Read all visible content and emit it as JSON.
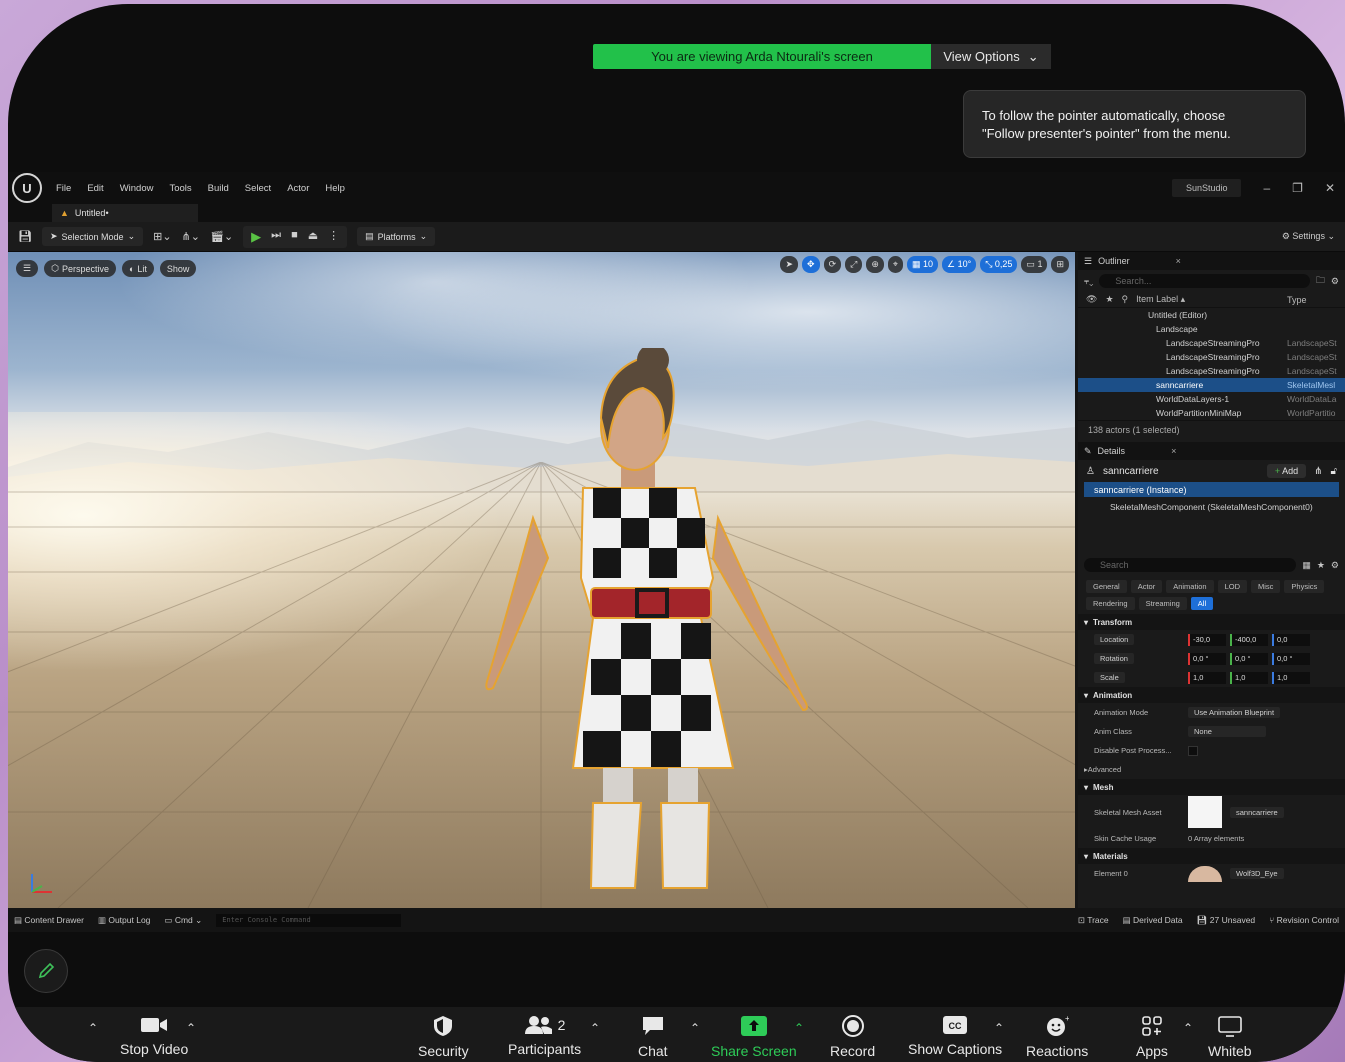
{
  "banner": {
    "viewing_text": "You are viewing Arda Ntourali's screen",
    "view_options": "View Options"
  },
  "tooltip": {
    "line1": "To follow the pointer automatically, choose",
    "line2": "\"Follow presenter's pointer\" from the menu."
  },
  "ue": {
    "menu": [
      "File",
      "Edit",
      "Window",
      "Tools",
      "Build",
      "Select",
      "Actor",
      "Help"
    ],
    "project_badge": "SunStudio",
    "tab_title": "Untitled•",
    "toolbar": {
      "selection_mode": "Selection Mode",
      "platforms": "Platforms",
      "settings": "Settings"
    },
    "viewport": {
      "perspective": "Perspective",
      "lit": "Lit",
      "show": "Show",
      "grid_snap": "10",
      "rotation_snap": "10°",
      "scale_snap": "0,25",
      "camera_speed": "1"
    },
    "outliner": {
      "title": "Outliner",
      "search_placeholder": "Search...",
      "col_label": "Item Label ▴",
      "col_type": "Type",
      "rows": [
        {
          "label": "Untitled (Editor)",
          "type": ""
        },
        {
          "label": "Landscape",
          "type": ""
        },
        {
          "label": "LandscapeStreamingPro",
          "type": "LandscapeSt"
        },
        {
          "label": "LandscapeStreamingPro",
          "type": "LandscapeSt"
        },
        {
          "label": "LandscapeStreamingPro",
          "type": "LandscapeSt"
        },
        {
          "label": "sanncarriere",
          "type": "SkeletalMesl"
        },
        {
          "label": "WorldDataLayers-1",
          "type": "WorldDataLa"
        },
        {
          "label": "WorldPartitionMiniMap",
          "type": "WorldPartitio"
        }
      ],
      "actor_count": "138 actors (1 selected)"
    },
    "details": {
      "title": "Details",
      "actor_name": "sanncarriere",
      "add_label": "Add",
      "instance": "sanncarriere (Instance)",
      "component": "SkeletalMeshComponent (SkeletalMeshComponent0)",
      "search_placeholder": "Search",
      "filters_row1": [
        "General",
        "Actor",
        "Animation",
        "LOD",
        "Misc"
      ],
      "filters_row2": [
        "Physics",
        "Rendering",
        "Streaming",
        "All"
      ],
      "transform": "Transform",
      "location_label": "Location",
      "location": [
        "-30,0",
        "-400,0",
        "0,0"
      ],
      "rotation_label": "Rotation",
      "rotation": [
        "0,0 °",
        "0,0 °",
        "0,0 °"
      ],
      "scale_label": "Scale",
      "scale": [
        "1,0",
        "1,0",
        "1,0"
      ],
      "animation": "Animation",
      "anim_mode_label": "Animation Mode",
      "anim_mode": "Use Animation Blueprint",
      "anim_class_label": "Anim Class",
      "anim_class": "None",
      "disable_post_label": "Disable Post Process...",
      "advanced": "Advanced",
      "mesh": "Mesh",
      "skeletal_mesh_asset_label": "Skeletal Mesh Asset",
      "skeletal_mesh_asset": "sanncarriere",
      "skin_cache_label": "Skin Cache Usage",
      "skin_cache": "0 Array elements",
      "materials": "Materials",
      "element0_label": "Element 0",
      "element0": "Wolf3D_Eye"
    },
    "statusbar": {
      "content_drawer": "Content Drawer",
      "output_log": "Output Log",
      "cmd": "Cmd",
      "console_placeholder": "Enter Console Command",
      "trace": "Trace",
      "derived_data": "Derived Data",
      "unsaved": "27 Unsaved",
      "revision_control": "Revision Control"
    }
  },
  "zoom": {
    "stop_video": "Stop Video",
    "security": "Security",
    "participants": "Participants",
    "participants_count": "2",
    "chat": "Chat",
    "share_screen": "Share Screen",
    "record": "Record",
    "show_captions": "Show Captions",
    "reactions": "Reactions",
    "apps": "Apps",
    "whiteboards": "Whiteb"
  },
  "colors": {
    "zoom_green": "#22c14a",
    "ue_select_blue": "#1c4f88",
    "accent_blue": "#1e6fd8"
  }
}
